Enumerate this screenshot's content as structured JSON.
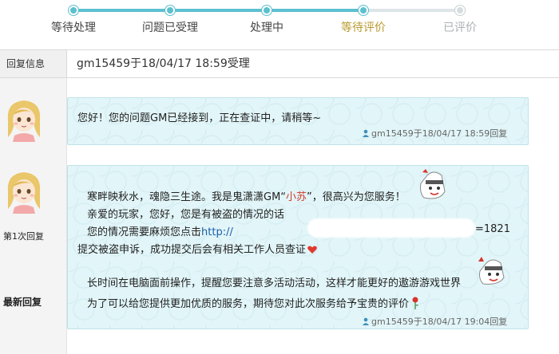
{
  "steps": [
    {
      "label": "等待处理",
      "state": "done"
    },
    {
      "label": "问题已受理",
      "state": "done"
    },
    {
      "label": "处理中",
      "state": "done"
    },
    {
      "label": "等待评价",
      "state": "current"
    },
    {
      "label": "已评价",
      "state": "pending"
    }
  ],
  "info": {
    "label": "回复信息",
    "text": "gm15459于18/04/17 18:59受理"
  },
  "sidebar": {
    "reply_1_label": "第1次回复",
    "latest_label": "最新回复"
  },
  "replies": [
    {
      "text": "您好！您的问题GM已经接到，正在查证中，请稍等~",
      "meta": "gm15459于18/04/17 18:59回复"
    },
    {
      "line1_pre": "寒畔映秋水，魂隐三生途。我是鬼潇潇GM“",
      "gm_name": "小苏",
      "line1_post": "”，很高兴为您服务！",
      "line2": "亲爱的玩家，您好，您是有被盗的情况的话",
      "line3_pre": "您的情况需要麻烦您点击",
      "line3_url": "http://",
      "line3_suffix": "=1821",
      "line4": "提交被盗申诉，成功提交后会有相关工作人员查证",
      "line5": "长时间在电脑面前操作，提醒您要注意多活动活动，这样才能更好的遨游游戏世界",
      "line6": "为了可以给您提供更加优质的服务，期待您对此次服务给予宝贵的评价",
      "meta": "gm15459于18/04/17 19:04回复"
    }
  ],
  "colors": {
    "accent": "#5cc0cf",
    "bubble_bg": "#e2f5f8",
    "gm_name": "#d23b2b",
    "current_step": "#b89a2e"
  }
}
